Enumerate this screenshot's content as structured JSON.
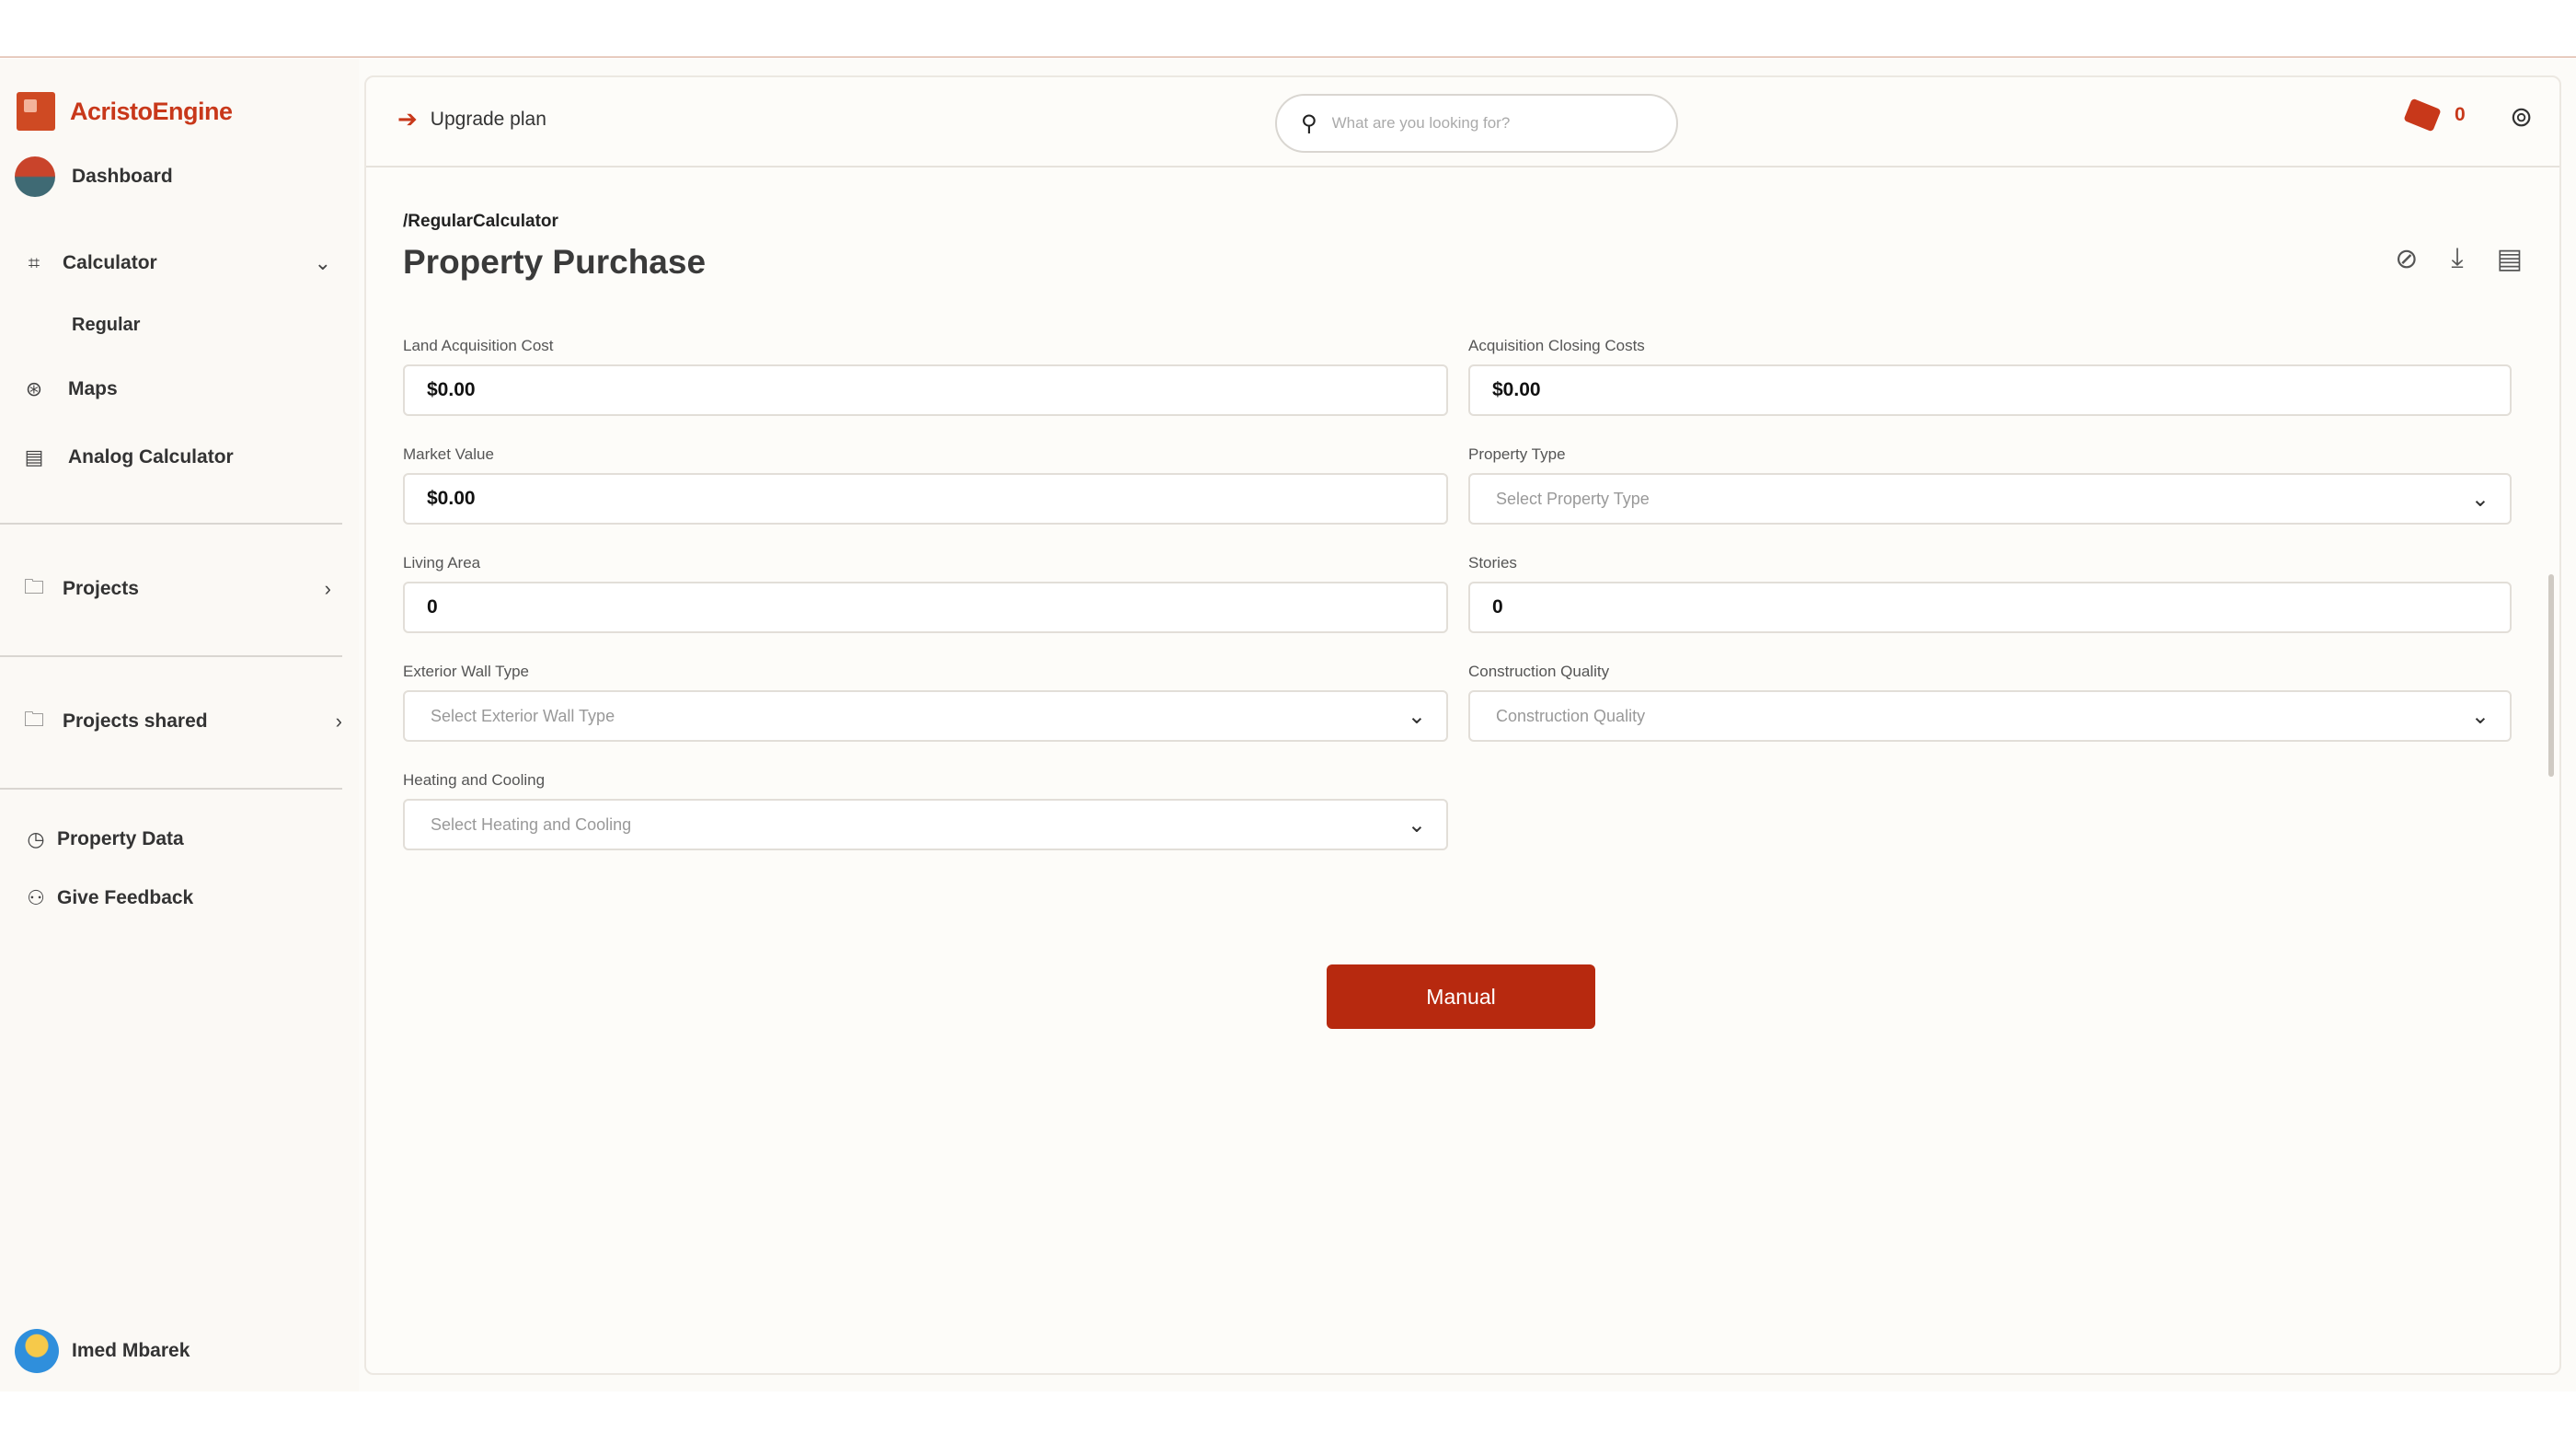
{
  "app": {
    "name": "AcristoEngine",
    "brand_color": "#c8381a",
    "button_color": "#b7290f"
  },
  "sidebar": {
    "items": [
      {
        "label": "Dashboard",
        "icon": "dashboard-avatar"
      },
      {
        "label": "Calculator",
        "icon": "calculator-icon",
        "expanded": true,
        "sub": [
          "Regular"
        ]
      },
      {
        "label": "Maps",
        "icon": "map-icon"
      },
      {
        "label": "Analog Calculator",
        "icon": "analog-calculator-icon"
      },
      {
        "label": "Projects",
        "icon": "folder-icon"
      },
      {
        "label": "Projects shared",
        "icon": "folder-icon"
      },
      {
        "label": "Property Data",
        "icon": "history-icon"
      },
      {
        "label": "Give Feedback",
        "icon": "feedback-icon"
      }
    ],
    "user": {
      "name": "Imed Mbarek"
    }
  },
  "topbar": {
    "upgrade_label": "Upgrade plan",
    "search_placeholder": "What are you looking for?",
    "credits": "0"
  },
  "page": {
    "breadcrumb": "/RegularCalculator",
    "title": "Property Purchase",
    "submit_label": "Manual"
  },
  "form": {
    "land_cost": {
      "label": "Land Acquisition Cost",
      "value": "$0.00"
    },
    "closing_costs": {
      "label": "Acquisition Closing Costs",
      "value": "$0.00"
    },
    "market_value": {
      "label": "Market Value",
      "value": "$0.00"
    },
    "property_type": {
      "label": "Property Type",
      "placeholder": "Select Property Type"
    },
    "living_area": {
      "label": "Living Area",
      "value": "0"
    },
    "stories": {
      "label": "Stories",
      "value": "0"
    },
    "exterior_wall": {
      "label": "Exterior Wall Type",
      "placeholder": "Select Exterior Wall Type"
    },
    "construction_quality": {
      "label": "Construction Quality",
      "placeholder": "Construction Quality"
    },
    "heating_cooling": {
      "label": "Heating and Cooling",
      "placeholder": "Select Heating and Cooling"
    }
  }
}
